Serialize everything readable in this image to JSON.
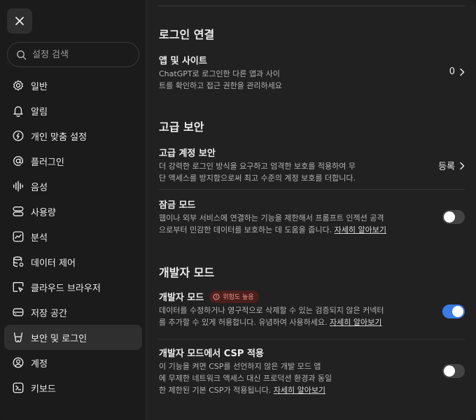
{
  "sidebar": {
    "search_placeholder": "설정 검색",
    "items": [
      {
        "label": "일반",
        "icon": "gear-icon"
      },
      {
        "label": "알림",
        "icon": "bell-icon"
      },
      {
        "label": "개인 맞춤 설정",
        "icon": "personalization-icon"
      },
      {
        "label": "플러그인",
        "icon": "at-sign-icon"
      },
      {
        "label": "음성",
        "icon": "waveform-icon"
      },
      {
        "label": "사용량",
        "icon": "usage-icon"
      },
      {
        "label": "분석",
        "icon": "analytics-icon"
      },
      {
        "label": "데이터 제어",
        "icon": "database-icon"
      },
      {
        "label": "클라우드 브라우저",
        "icon": "cloud-browser-icon"
      },
      {
        "label": "저장 공간",
        "icon": "storage-icon"
      },
      {
        "label": "보안 및 로그인",
        "icon": "security-icon",
        "active": true
      },
      {
        "label": "계정",
        "icon": "account-icon"
      },
      {
        "label": "키보드",
        "icon": "keyboard-icon"
      }
    ]
  },
  "main": {
    "login_section": {
      "title": "로그인 연결",
      "apps": {
        "title": "앱 및 사이트",
        "desc_line1": "ChatGPT로 로그인한 다른 앱과 사이",
        "desc_line2": "트를 확인하고 접근 권한을 관리하세요",
        "count": "0"
      }
    },
    "advanced_section": {
      "title": "고급 보안",
      "account_security": {
        "title": "고급 계정 보안",
        "desc_line1": "더 강력한 로그인 방식을 요구하고 엄격한 보호를 적용하여 무",
        "desc_line2": "단 액세스를 방지함으로써 최고 수준의 계정 보호를 더합니다.",
        "action": "등록"
      },
      "lockdown": {
        "title": "잠금 모드",
        "desc_line1": "웹이나 외부 서비스에 연결하는 기능을 제한해서 프롬프트 인젝션 공격",
        "desc_line2": "으로부터 민감한 데이터를 보호하는 데 도움을 줍니다.",
        "link": "자세히 알아보기",
        "enabled": false
      }
    },
    "developer_section": {
      "title": "개발자 모드",
      "dev_mode": {
        "title": "개발자 모드",
        "badge": "위험도 높음",
        "desc_line1": "데이터를 수정하거나 영구적으로 삭제할 수 있는 검증되지 않은 커넥터",
        "desc_line2": "를 추가할 수 있게 허용합니다. 유념하여 사용하세요.",
        "link": "자세히 알아보기",
        "enabled": true
      },
      "csp": {
        "title": "개발자 모드에서 CSP 적용",
        "desc_line1": "이 기능을 켜면 CSP를 선언하지 않은 개발 모드 앱",
        "desc_line2": "에 무제한 네트워크 액세스 대신 프로덕션 환경과 동일",
        "desc_line3": "한 제한된 기본 CSP가 적용됩니다.",
        "link": "자세히 알아보기",
        "enabled": false
      }
    }
  },
  "colors": {
    "accent": "#3a7be5",
    "badge_bg": "#4a1f1d",
    "badge_text": "#f39a90"
  }
}
